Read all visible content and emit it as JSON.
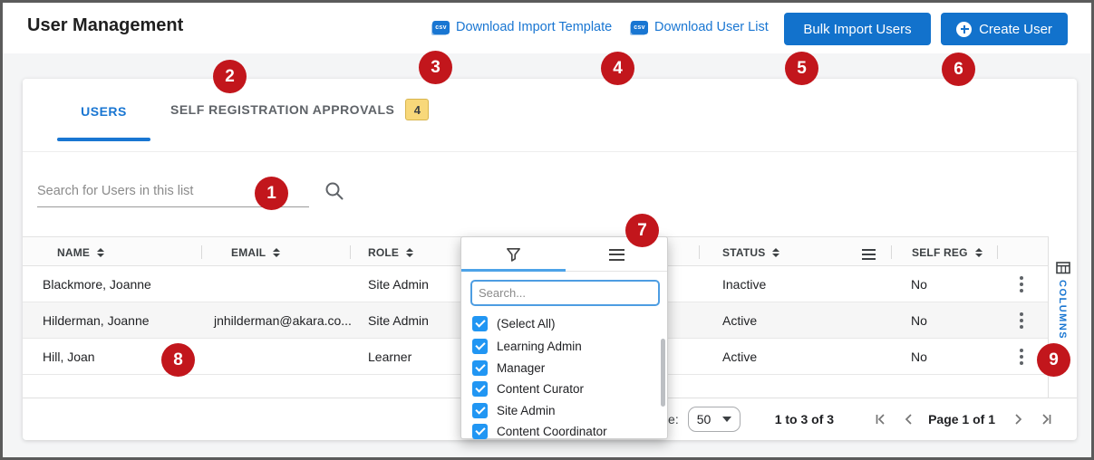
{
  "header": {
    "title": "User Management",
    "links": [
      {
        "label": "Download Import Template",
        "icon_text": "csv"
      },
      {
        "label": "Download User List",
        "icon_text": "csv"
      }
    ],
    "bulk_import_label": "Bulk Import Users",
    "create_user_label": "Create User"
  },
  "tabs": {
    "users_label": "USERS",
    "self_reg_label": "SELF REGISTRATION APPROVALS",
    "self_reg_badge": "4"
  },
  "search": {
    "placeholder": "Search for Users in this list"
  },
  "table": {
    "columns": {
      "name": "NAME",
      "email": "EMAIL",
      "role": "ROLE",
      "status": "STATUS",
      "self_reg": "SELF REG"
    },
    "rows": [
      {
        "name": "Blackmore, Joanne",
        "email": "",
        "role": "Site Admin",
        "status": "Inactive",
        "self_reg": "No"
      },
      {
        "name": "Hilderman, Joanne",
        "email": "jnhilderman@akara.co...",
        "role": "Site Admin",
        "status": "Active",
        "self_reg": "No"
      },
      {
        "name": "Hill, Joan",
        "email": "",
        "role": "Learner",
        "status": "Active",
        "self_reg": "No"
      }
    ]
  },
  "filter_popup": {
    "search_placeholder": "Search...",
    "options": [
      "(Select All)",
      "Learning Admin",
      "Manager",
      "Content Curator",
      "Site Admin",
      "Content Coordinator"
    ]
  },
  "footer": {
    "page_size_label": "Page Size:",
    "page_size_value": "50",
    "range_text": "1 to 3 of 3",
    "page_text": "Page 1 of 1"
  },
  "columns_panel": {
    "label": "COLUMNS"
  },
  "annotations": {
    "b1": "1",
    "b2": "2",
    "b3": "3",
    "b4": "4",
    "b5": "5",
    "b6": "6",
    "b7": "7",
    "b8": "8",
    "b9": "9"
  },
  "colors": {
    "primary_blue": "#1976d2",
    "button_blue": "#1272cc",
    "annotation_red": "#c2161c",
    "tab_badge_yellow": "#f8d87a",
    "checkbox_blue": "#2196f3"
  }
}
